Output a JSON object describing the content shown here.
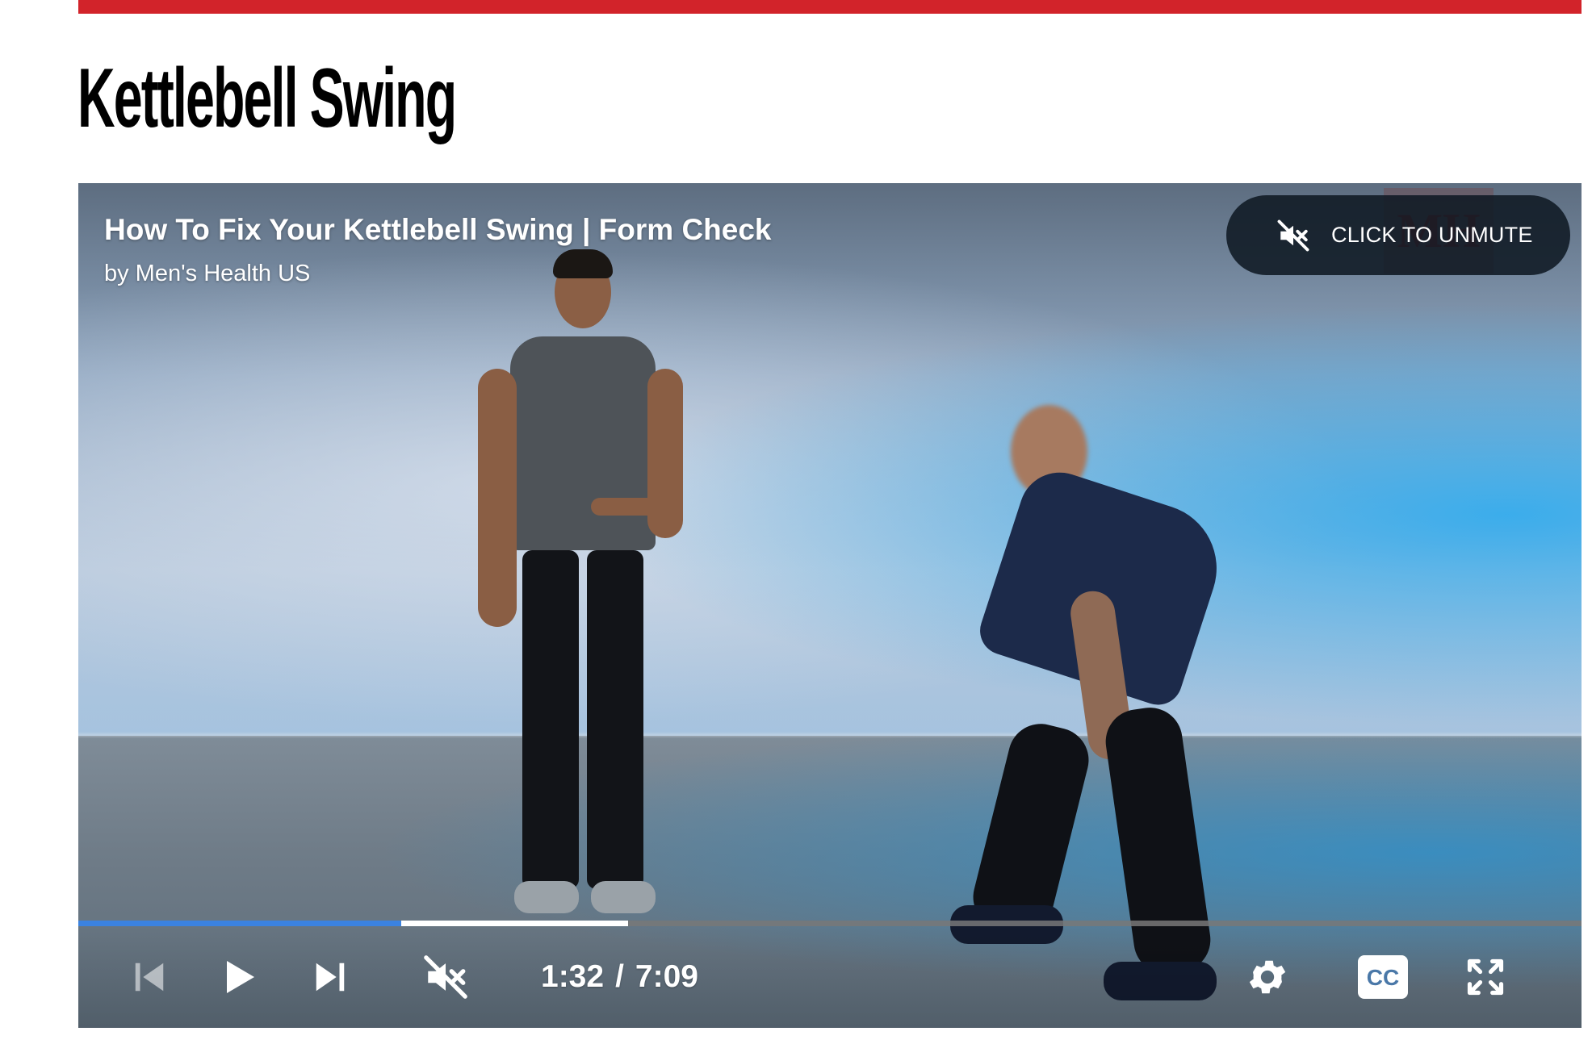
{
  "page": {
    "title": "Kettlebell Swing",
    "accent_color": "#d2232a"
  },
  "video": {
    "title": "How To Fix Your Kettlebell Swing | Form Check",
    "byline": "by Men's Health US",
    "watermark": "MH",
    "unmute_label": "CLICK TO UNMUTE",
    "current_time": "1:32",
    "time_separator": "/",
    "duration": "7:09",
    "progress_played_fraction": 0.215,
    "progress_buffered_fraction": 0.366,
    "progress_color": "#3b82e0",
    "muted": true
  },
  "controls": {
    "icons": [
      "previous-icon",
      "play-icon",
      "next-icon",
      "muted-volume-icon",
      "settings-icon",
      "closed-captions-icon",
      "fullscreen-icon"
    ],
    "cc_label": "CC"
  }
}
